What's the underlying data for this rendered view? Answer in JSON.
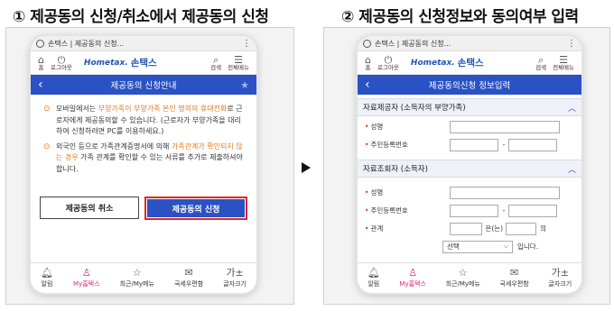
{
  "left": {
    "step_title": "① 제공동의 신청/취소에서 제공동의 신청",
    "browser_tab": "손택스 | 제공동의 신청...",
    "appbar": {
      "home": "홈",
      "logout": "로그아웃",
      "logo_hometax": "Hometax.",
      "logo_sontax": "손택스",
      "search": "검색",
      "menu": "전체메뉴"
    },
    "nav_title": "제공동의 신청안내",
    "notice_1_parts": [
      "모바일에서는 ",
      "부양가족이 부양가족 본인 명의의 휴대전화",
      "로 근로자에게 제공동의할 수 있습니다. (근로자가 부양가족을 대리하여 신청하려면 PC를 이용하세요.)"
    ],
    "notice_2_parts": [
      "외국인 등으로 가족관계증명서에 의해 ",
      "가족관계가 확인되지 않는 경우",
      " 가족 관계를 확인할 수 있는 서류를 추가로 제출하셔야 합니다."
    ],
    "cancel_button": "제공동의 취소",
    "apply_button": "제공동의 신청"
  },
  "right": {
    "step_title": "② 제공동의 신청정보와 동의여부 입력",
    "browser_tab": "손택스 | 제공동의 신청...",
    "appbar": {
      "home": "홈",
      "logout": "로그아웃",
      "logo_hometax": "Hometax.",
      "logo_sontax": "손택스",
      "search": "검색",
      "menu": "전체메뉴"
    },
    "nav_title": "제공동의신청 정보입력",
    "section1": "자료제공자 (소득자의 부양가족)",
    "section2": "자료조회자 (소득자)",
    "name_label": "성명",
    "ssn_label": "주민등록번호",
    "relation_label": "관계",
    "relation_mid": "은(는)",
    "relation_of": "의",
    "select_placeholder": "선택",
    "relation_end": "입니다."
  },
  "bottom_nav": [
    "알림",
    "My홈택스",
    "최근/My메뉴",
    "국세우편함",
    "글자크기"
  ],
  "bottom_nav_icons": [
    "bell-icon",
    "person-icon",
    "star-icon",
    "mail-icon",
    "font-size-icon"
  ],
  "colors": {
    "primary": "#2a52c4",
    "orange": "#e07b20",
    "highlight_red": "#e0262c",
    "active_pink": "#e0267a"
  }
}
